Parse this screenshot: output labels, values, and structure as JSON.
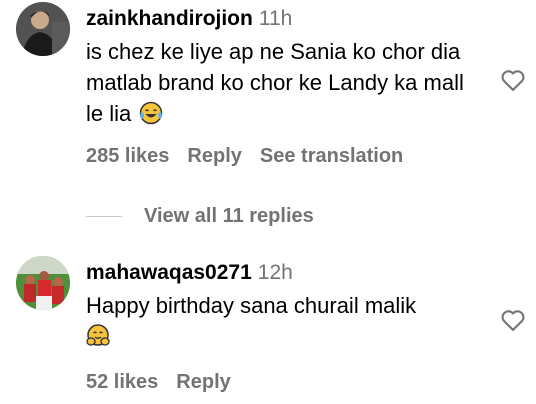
{
  "comments": [
    {
      "username": "zainkhandirojion",
      "time": "11h",
      "text": "is chez ke liye ap ne Sania ko chor dia matlab brand ko chor ke Landy ka mall le lia",
      "emoji": "face-with-tears-of-joy",
      "likes": "285 likes",
      "reply": "Reply",
      "translation": "See translation"
    },
    {
      "username": "mahawaqas0271",
      "time": "12h",
      "text": "Happy birthday sana churail malik",
      "emoji": "hugging-face",
      "likes": "52 likes",
      "reply": "Reply"
    }
  ],
  "view_replies": "View all 11 replies",
  "colors": {
    "secondary_text": "#737373",
    "primary_text": "#000000",
    "divider": "#c7c7c7"
  },
  "icons": [
    "heart-outline-icon",
    "face-with-tears-of-joy",
    "hugging-face"
  ]
}
